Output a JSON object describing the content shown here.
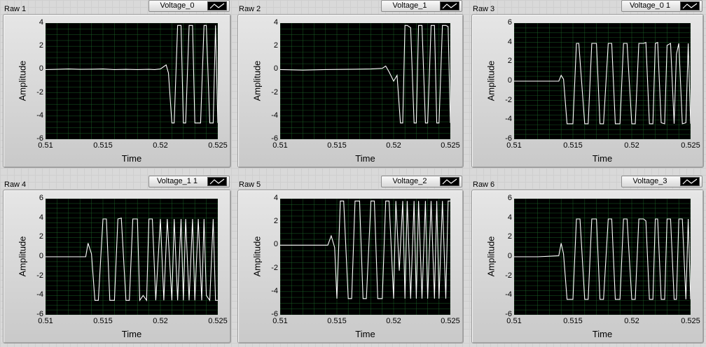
{
  "charts": [
    {
      "title": "Raw 1",
      "legend": "Voltage_0",
      "xlabel": "Time",
      "ylabel": "Amplitude",
      "xlim": [
        0.51,
        0.525
      ],
      "ylim": [
        -6,
        4
      ],
      "xticks": [
        "0.51",
        "0.515",
        "0.52",
        "0.525"
      ],
      "yticks": [
        "4",
        "2",
        "0",
        "-2",
        "-4",
        "-6"
      ],
      "xtickvals": [
        0.51,
        0.515,
        0.52,
        0.525
      ],
      "ytickvals": [
        4,
        2,
        0,
        -2,
        -4,
        -6
      ],
      "x": [
        0.51,
        0.511,
        0.512,
        0.513,
        0.514,
        0.515,
        0.516,
        0.517,
        0.518,
        0.519,
        0.5195,
        0.52,
        0.5205,
        0.5207,
        0.521,
        0.5212,
        0.5215,
        0.5218,
        0.522,
        0.5222,
        0.5225,
        0.5228,
        0.523,
        0.5232,
        0.5235,
        0.5238,
        0.524,
        0.5243,
        0.5246,
        0.5248,
        0.525
      ],
      "y": [
        0,
        0.02,
        0.05,
        0.02,
        0.03,
        0.05,
        0.0,
        0.02,
        0.0,
        0.02,
        0.0,
        0.05,
        0.4,
        -0.3,
        -4.6,
        -4.6,
        3.8,
        3.8,
        -4.6,
        -4.6,
        3.8,
        3.8,
        -4.6,
        -4.6,
        -4.6,
        3.8,
        3.8,
        -4.6,
        -4.6,
        3.8,
        -4.6
      ]
    },
    {
      "title": "Raw 2",
      "legend": "Voltage_1",
      "xlabel": "Time",
      "ylabel": "Amplitude",
      "xlim": [
        0.51,
        0.525
      ],
      "ylim": [
        -6,
        4
      ],
      "xticks": [
        "0.51",
        "0.515",
        "0.52",
        "0.525"
      ],
      "yticks": [
        "4",
        "2",
        "0",
        "-2",
        "-4",
        "-6"
      ],
      "xtickvals": [
        0.51,
        0.515,
        0.52,
        0.525
      ],
      "ytickvals": [
        4,
        2,
        0,
        -2,
        -4,
        -6
      ],
      "x": [
        0.51,
        0.512,
        0.514,
        0.516,
        0.518,
        0.519,
        0.5193,
        0.5196,
        0.52,
        0.5203,
        0.5206,
        0.5208,
        0.521,
        0.5212,
        0.5215,
        0.5218,
        0.522,
        0.5222,
        0.5225,
        0.5228,
        0.523,
        0.5233,
        0.5236,
        0.5238,
        0.524,
        0.5243,
        0.5246,
        0.5248,
        0.525
      ],
      "y": [
        0,
        -0.05,
        0.0,
        0.02,
        0.05,
        0.1,
        0.3,
        -0.2,
        -1.0,
        -0.5,
        -4.6,
        -4.6,
        3.8,
        3.8,
        3.6,
        -4.6,
        -4.6,
        3.8,
        3.8,
        -4.6,
        -4.6,
        3.8,
        3.8,
        -4.6,
        -4.6,
        3.8,
        3.8,
        3.7,
        -4.6
      ]
    },
    {
      "title": "Raw 3",
      "legend": "Voltage_0 1",
      "xlabel": "Time",
      "ylabel": "Amplitude",
      "xlim": [
        0.51,
        0.525
      ],
      "ylim": [
        -6,
        6
      ],
      "xticks": [
        "0.51",
        "0.515",
        "0.52",
        "0.525"
      ],
      "yticks": [
        "6",
        "4",
        "2",
        "0",
        "-2",
        "-4",
        "-6"
      ],
      "xtickvals": [
        0.51,
        0.515,
        0.52,
        0.525
      ],
      "ytickvals": [
        6,
        4,
        2,
        0,
        -2,
        -4,
        -6
      ],
      "x": [
        0.51,
        0.512,
        0.5138,
        0.514,
        0.5142,
        0.5145,
        0.515,
        0.5153,
        0.5155,
        0.516,
        0.5163,
        0.5166,
        0.517,
        0.5173,
        0.5176,
        0.518,
        0.5183,
        0.5186,
        0.519,
        0.5193,
        0.5196,
        0.52,
        0.5203,
        0.5206,
        0.521,
        0.5212,
        0.5215,
        0.5218,
        0.522,
        0.5222,
        0.5225,
        0.5228,
        0.523,
        0.5233,
        0.5236,
        0.5238,
        0.524,
        0.5243,
        0.5246,
        0.5248,
        0.525
      ],
      "y": [
        0,
        0,
        0,
        0.6,
        0.2,
        -4.4,
        -4.4,
        3.9,
        3.9,
        -4.4,
        -4.4,
        3.9,
        3.9,
        -4.4,
        -4.4,
        3.9,
        3.9,
        -4.4,
        -4.4,
        3.9,
        3.9,
        -4.4,
        -4.4,
        3.9,
        3.9,
        4.0,
        -4.4,
        -4.4,
        3.9,
        4.0,
        -4.3,
        -4.4,
        3.7,
        3.9,
        -4.4,
        2.8,
        3.9,
        -4.4,
        -4.3,
        3.9,
        -4.4
      ]
    },
    {
      "title": "Raw 4",
      "legend": "Voltage_1 1",
      "xlabel": "Time",
      "ylabel": "Amplitude",
      "xlim": [
        0.51,
        0.525
      ],
      "ylim": [
        -6,
        6
      ],
      "xticks": [
        "0.51",
        "0.515",
        "0.52",
        "0.525"
      ],
      "yticks": [
        "6",
        "4",
        "2",
        "0",
        "-2",
        "-4",
        "-6"
      ],
      "xtickvals": [
        0.51,
        0.515,
        0.52,
        0.525
      ],
      "ytickvals": [
        6,
        4,
        2,
        0,
        -2,
        -4,
        -6
      ],
      "x": [
        0.51,
        0.512,
        0.5135,
        0.5137,
        0.514,
        0.5143,
        0.5146,
        0.515,
        0.5153,
        0.5156,
        0.516,
        0.5163,
        0.5166,
        0.517,
        0.5173,
        0.5176,
        0.518,
        0.5182,
        0.5185,
        0.5188,
        0.519,
        0.5193,
        0.5196,
        0.52,
        0.5203,
        0.5206,
        0.521,
        0.5212,
        0.5215,
        0.5218,
        0.522,
        0.5222,
        0.5225,
        0.5228,
        0.523,
        0.5233,
        0.5236,
        0.5238,
        0.524,
        0.5243,
        0.5246,
        0.5248,
        0.525
      ],
      "y": [
        0,
        0,
        0,
        1.4,
        0.3,
        -4.5,
        -4.5,
        3.9,
        3.9,
        -4.5,
        -4.5,
        3.9,
        4.0,
        -4.5,
        -4.5,
        3.9,
        3.9,
        -4.5,
        -4.0,
        -4.5,
        3.9,
        3.9,
        -4.5,
        3.9,
        -4.5,
        3.9,
        -4.5,
        3.9,
        -4.5,
        3.9,
        -4.5,
        3.9,
        -4.5,
        3.9,
        -4.5,
        3.9,
        -4.5,
        3.9,
        -4.0,
        -4.5,
        3.9,
        -4.5,
        -4.5
      ]
    },
    {
      "title": "Raw 5",
      "legend": "Voltage_2",
      "xlabel": "Time",
      "ylabel": "Amplitude",
      "xlim": [
        0.51,
        0.525
      ],
      "ylim": [
        -6,
        4
      ],
      "xticks": [
        "0.51",
        "0.515",
        "0.52",
        "0.525"
      ],
      "yticks": [
        "4",
        "2",
        "0",
        "-2",
        "-4",
        "-6"
      ],
      "xtickvals": [
        0.51,
        0.515,
        0.52,
        0.525
      ],
      "ytickvals": [
        4,
        2,
        0,
        -2,
        -4,
        -6
      ],
      "x": [
        0.51,
        0.512,
        0.5142,
        0.5145,
        0.5148,
        0.515,
        0.5153,
        0.5156,
        0.516,
        0.5163,
        0.5166,
        0.517,
        0.5173,
        0.5176,
        0.518,
        0.5183,
        0.5186,
        0.519,
        0.5193,
        0.5196,
        0.52,
        0.5202,
        0.5205,
        0.5208,
        0.521,
        0.5212,
        0.5215,
        0.5218,
        0.522,
        0.5222,
        0.5225,
        0.5228,
        0.523,
        0.5233,
        0.5236,
        0.5238,
        0.524,
        0.5243,
        0.5246,
        0.5248,
        0.525
      ],
      "y": [
        0,
        0,
        0,
        0.8,
        -0.2,
        -4.6,
        3.8,
        3.8,
        -4.6,
        -4.6,
        3.8,
        3.8,
        -4.6,
        -4.6,
        3.8,
        3.8,
        -4.6,
        -4.6,
        3.8,
        3.8,
        -4.6,
        3.8,
        -2.2,
        3.8,
        -4.6,
        3.8,
        -4.6,
        3.8,
        -4.6,
        3.8,
        -4.6,
        3.8,
        -4.6,
        3.8,
        -4.6,
        3.8,
        -4.6,
        3.8,
        -4.6,
        3.8,
        3.8
      ]
    },
    {
      "title": "Raw 6",
      "legend": "Voltage_3",
      "xlabel": "Time",
      "ylabel": "Amplitude",
      "xlim": [
        0.51,
        0.525
      ],
      "ylim": [
        -6,
        6
      ],
      "xticks": [
        "0.51",
        "0.515",
        "0.52",
        "0.525"
      ],
      "yticks": [
        "6",
        "4",
        "2",
        "0",
        "-2",
        "-4",
        "-6"
      ],
      "xtickvals": [
        0.51,
        0.515,
        0.52,
        0.525
      ],
      "ytickvals": [
        6,
        4,
        2,
        0,
        -2,
        -4,
        -6
      ],
      "x": [
        0.51,
        0.512,
        0.5138,
        0.514,
        0.5142,
        0.5145,
        0.515,
        0.5153,
        0.5156,
        0.516,
        0.5163,
        0.5166,
        0.517,
        0.5173,
        0.5176,
        0.518,
        0.5183,
        0.5186,
        0.519,
        0.5193,
        0.5196,
        0.52,
        0.5203,
        0.5206,
        0.521,
        0.5212,
        0.5215,
        0.5218,
        0.522,
        0.5222,
        0.5225,
        0.5228,
        0.523,
        0.5233,
        0.5236,
        0.5238,
        0.524,
        0.5243,
        0.5246,
        0.5248,
        0.525
      ],
      "y": [
        0,
        0,
        0.1,
        1.4,
        0.3,
        -4.4,
        -4.4,
        3.9,
        3.9,
        -4.4,
        -4.4,
        3.9,
        3.9,
        -4.4,
        -4.4,
        3.9,
        3.9,
        -4.4,
        -4.4,
        3.9,
        3.9,
        -4.4,
        -4.4,
        3.9,
        3.9,
        3.7,
        -4.4,
        -4.4,
        3.9,
        3.9,
        -4.4,
        -4.4,
        3.9,
        3.9,
        -4.4,
        -4.4,
        3.9,
        3.9,
        -4.4,
        3.9,
        -4.4
      ]
    }
  ],
  "colors": {
    "plot_bg": "#000000",
    "grid": "#1f6b2b",
    "trace": "#ffffff"
  }
}
